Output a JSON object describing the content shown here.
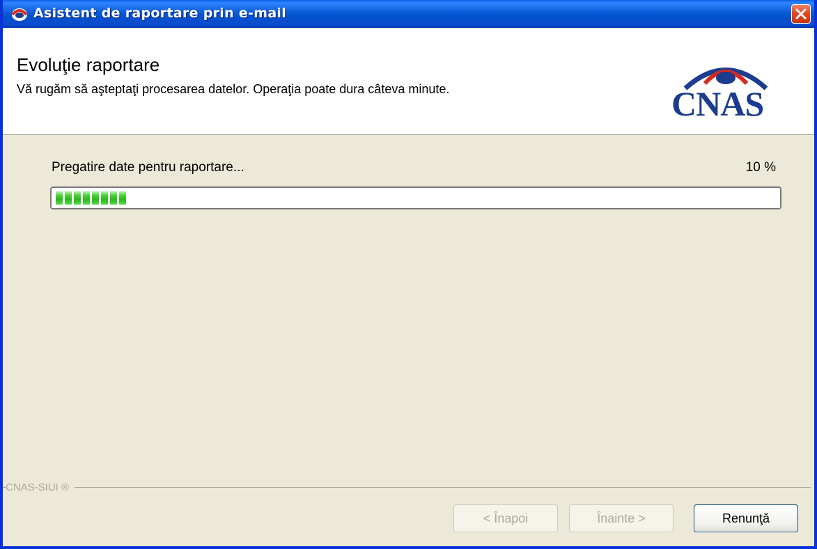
{
  "window": {
    "title": "Asistent de raportare prin e-mail"
  },
  "header": {
    "title": "Evoluţie raportare",
    "subtitle": "Vă rugăm să aşteptaţi procesarea datelor. Operaţia poate dura câteva minute.",
    "logo_text": "CNAS"
  },
  "progress": {
    "status": "Pregatire date pentru raportare...",
    "percent_label": "10 %",
    "value": 10
  },
  "footer": {
    "brand": "CNAS-SIUI ®"
  },
  "buttons": {
    "back": "< Înapoi",
    "next": "Înainte >",
    "cancel": "Renunţă"
  },
  "colors": {
    "titlebar": "#0a4ccc",
    "dialog_bg": "#ece9d8",
    "progress_fill": "#2bb81e",
    "logo": "#1b3c8f"
  },
  "icons": {
    "title": "cnas-app-icon",
    "close": "close-icon",
    "logo": "cnas-logo"
  }
}
